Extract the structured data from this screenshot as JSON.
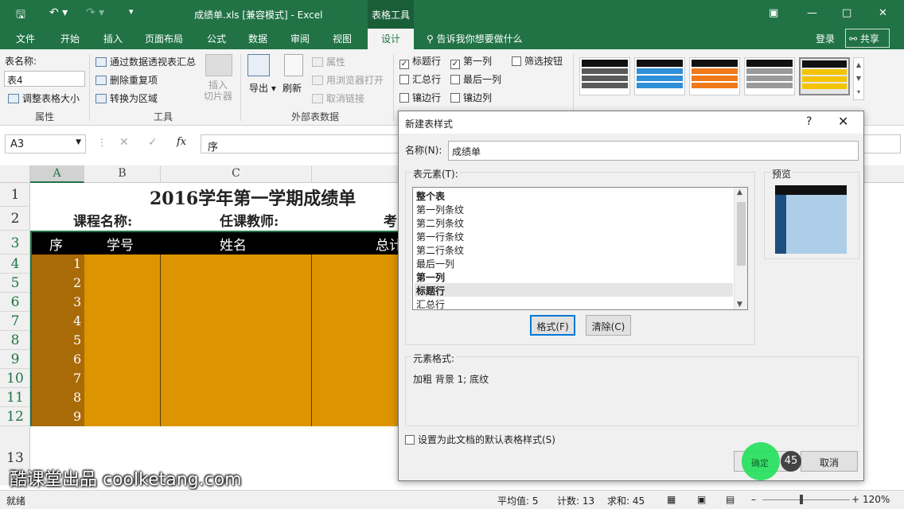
{
  "app": {
    "title": "成绩单.xls  [兼容模式] - Excel",
    "context_tab": "表格工具"
  },
  "tabs": [
    "文件",
    "开始",
    "插入",
    "页面布局",
    "公式",
    "数据",
    "审阅",
    "视图",
    "设计"
  ],
  "tell_me": "告诉我你想要做什么",
  "login": "登录",
  "share": "共享",
  "ribbon": {
    "properties": {
      "label": "表名称:",
      "table_name": "表4",
      "resize": "调整表格大小",
      "group": "属性"
    },
    "tools": {
      "pivot": "通过数据透视表汇总",
      "remove_dup": "删除重复项",
      "convert": "转换为区域",
      "slicer": "插入\n切片器",
      "group": "工具"
    },
    "external": {
      "export": "导出",
      "refresh": "刷新",
      "properties": "属性",
      "open_browser": "用浏览器打开",
      "unlink": "取消链接",
      "group": "外部表数据"
    },
    "style_options": {
      "header_row": "标题行",
      "first_col": "第一列",
      "filter_btn": "筛选按钮",
      "total_row": "汇总行",
      "last_col": "最后一列",
      "banded_rows": "镶边行",
      "banded_cols": "镶边列"
    },
    "swatch_colors": [
      "#5a5a5a",
      "#2f8fd8",
      "#ef7a1a",
      "#9a9a9a",
      "#f5c400"
    ]
  },
  "formula": {
    "cell_ref": "A3",
    "content": "序"
  },
  "sheet": {
    "columns": [
      "A",
      "B",
      "C"
    ],
    "rows": [
      "1",
      "2",
      "3",
      "4",
      "5",
      "6",
      "7",
      "8",
      "9",
      "10",
      "11",
      "12",
      "13"
    ],
    "title": "2016学年第一学期成绩单",
    "course_label": "课程名称:",
    "teacher_label": "任课教师:",
    "exam_label_partial": "考",
    "headers": [
      "序",
      "学号",
      "姓名",
      "总计"
    ],
    "serials": [
      "1",
      "2",
      "3",
      "4",
      "5",
      "6",
      "7",
      "8",
      "9"
    ]
  },
  "dialog": {
    "title": "新建表样式",
    "help": "?",
    "name_label": "名称(N):",
    "name_value": "成绩单",
    "elements_label": "表元素(T):",
    "elements": [
      "整个表",
      "第一列条纹",
      "第二列条纹",
      "第一行条纹",
      "第二行条纹",
      "最后一列",
      "第一列",
      "标题行",
      "汇总行"
    ],
    "format_btn": "格式(F)",
    "clear_btn": "清除(C)",
    "preview_label": "预览",
    "element_format_label": "元素格式:",
    "element_format_value": "加粗 背景 1; 底纹",
    "default_checkbox": "设置为此文档的默认表格样式(S)",
    "ok_btn": "确定",
    "cancel_btn": "取消",
    "step_badge": "45"
  },
  "watermark": "酷课堂出品 coolketang.com",
  "status": {
    "ready": "就绪",
    "average": "平均值: 5",
    "count": "计数: 13",
    "sum": "求和: 45",
    "zoom": "120%"
  },
  "colors": {
    "excel_green": "#217346",
    "table_orange": "#dc9400",
    "table_dark_orange": "#a86b08",
    "header_black": "#000000"
  }
}
